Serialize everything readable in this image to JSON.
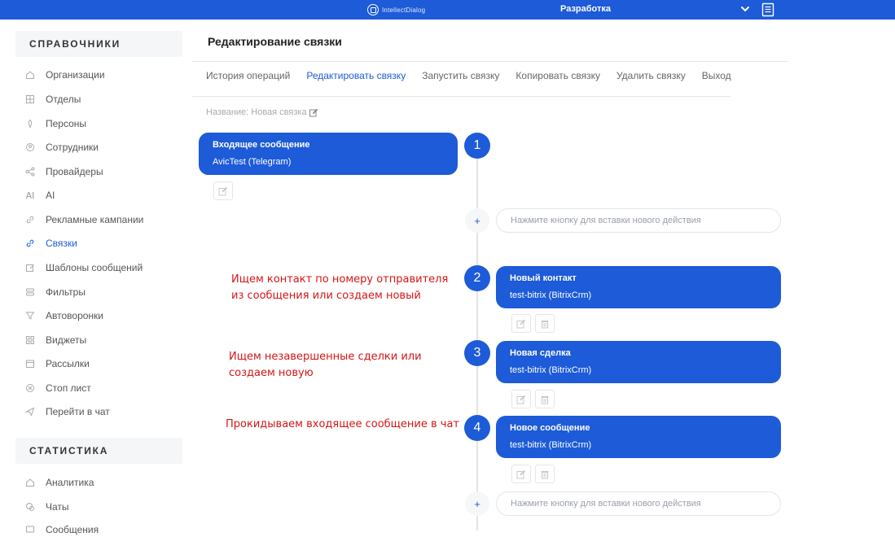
{
  "topbar": {
    "logo_text": "IntellectDialog",
    "environment": "Разработка"
  },
  "sidebar": {
    "directories_header": "СПРАВОЧНИКИ",
    "directories": [
      {
        "label": "Организации",
        "icon": "home-icon"
      },
      {
        "label": "Отделы",
        "icon": "grid-icon"
      },
      {
        "label": "Персоны",
        "icon": "person-icon"
      },
      {
        "label": "Сотрудники",
        "icon": "employee-icon"
      },
      {
        "label": "Провайдеры",
        "icon": "share-icon"
      },
      {
        "label": "AI",
        "icon": "ai-icon"
      },
      {
        "label": "Рекламные кампании",
        "icon": "link-icon"
      },
      {
        "label": "Связки",
        "icon": "link-icon"
      },
      {
        "label": "Шаблоны сообщений",
        "icon": "edit-icon"
      },
      {
        "label": "Фильтры",
        "icon": "filter-icon"
      },
      {
        "label": "Автоворонки",
        "icon": "funnel-icon"
      },
      {
        "label": "Виджеты",
        "icon": "widgets-icon"
      },
      {
        "label": "Рассылки",
        "icon": "calendar-icon"
      },
      {
        "label": "Стоп лист",
        "icon": "block-icon"
      },
      {
        "label": "Перейти в чат",
        "icon": "send-icon"
      }
    ],
    "active_index": 7,
    "statistics_header": "СТАТИСТИКА",
    "statistics": [
      {
        "label": "Аналитика",
        "icon": "analytics-icon"
      },
      {
        "label": "Чаты",
        "icon": "chats-icon"
      },
      {
        "label": "Сообщения",
        "icon": "messages-icon"
      }
    ]
  },
  "main": {
    "title": "Редактирование связки",
    "tabs": [
      {
        "label": "История операций"
      },
      {
        "label": "Редактировать связку"
      },
      {
        "label": "Запустить связку"
      },
      {
        "label": "Копировать связку"
      },
      {
        "label": "Удалить связку"
      },
      {
        "label": "Выход"
      }
    ],
    "active_tab": 1,
    "name_line": "Название: Новая связка"
  },
  "flow": {
    "steps": [
      {
        "number": "1",
        "title": "Входящее сообщение",
        "subtitle": "AvicTest (Telegram)"
      },
      {
        "number": "2",
        "title": "Новый контакт",
        "subtitle": "test-bitrix (BitrixCrm)"
      },
      {
        "number": "3",
        "title": "Новая сделка",
        "subtitle": "test-bitrix (BitrixCrm)"
      },
      {
        "number": "4",
        "title": "Новое сообщение",
        "subtitle": "test-bitrix (BitrixCrm)"
      }
    ],
    "insert_placeholder": "Нажмите кнопку для вставки нового действия",
    "plus_label": "+",
    "notes": [
      {
        "line1": "Ищем контакт по номеру отправителя",
        "line2": "из сообщения или создаем новый"
      },
      {
        "line1": "Ищем незавершенные сделки или",
        "line2": "создаем новую"
      },
      {
        "line1": "Прокидываем входящее сообщение в чат",
        "line2": ""
      }
    ]
  },
  "colors": {
    "accent": "#1d5bd8",
    "note": "#d51616"
  }
}
